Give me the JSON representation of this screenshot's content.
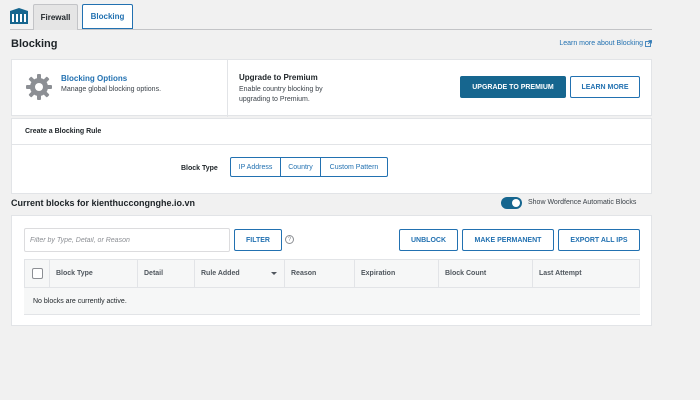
{
  "tabs": [
    {
      "label": "Firewall"
    },
    {
      "label": "Blocking"
    }
  ],
  "page": {
    "title": "Blocking",
    "learn_more": "Learn more about Blocking"
  },
  "options_panel": {
    "title": "Blocking Options",
    "subtitle": "Manage global blocking options.",
    "premium_title": "Upgrade to Premium",
    "premium_text": "Enable country blocking by upgrading to Premium.",
    "upgrade_label": "UPGRADE TO PREMIUM",
    "learn_more_label": "LEARN MORE"
  },
  "create_rule": {
    "title": "Create a Blocking Rule",
    "block_type_label": "Block Type",
    "types": [
      "IP Address",
      "Country",
      "Custom Pattern"
    ]
  },
  "current_blocks": {
    "title": "Current blocks for kienthuccongnghe.io.vn",
    "toggle_label": "Show Wordfence Automatic Blocks",
    "toggle_on": true,
    "filter_placeholder": "Filter by Type, Detail, or Reason",
    "filter_label": "FILTER",
    "help_glyph": "?",
    "unblock_label": "UNBLOCK",
    "make_permanent_label": "MAKE PERMANENT",
    "export_label": "EXPORT ALL IPS",
    "columns": [
      "Block Type",
      "Detail",
      "Rule Added",
      "Reason",
      "Expiration",
      "Block Count",
      "Last Attempt"
    ],
    "empty_message": "No blocks are currently active."
  },
  "colors": {
    "accent": "#2271b1",
    "primary_button": "#16668f"
  }
}
